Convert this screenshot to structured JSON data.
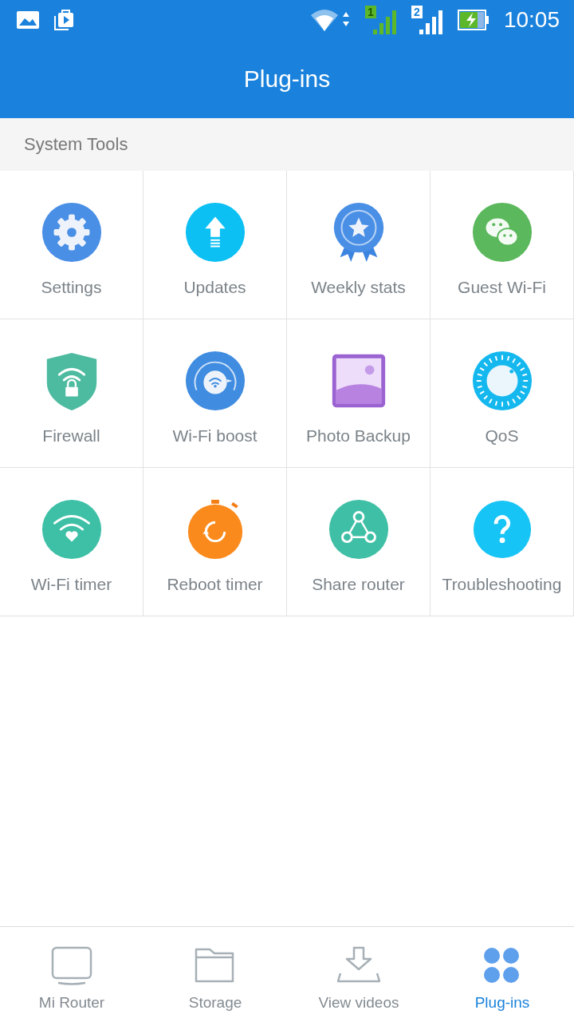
{
  "status_bar": {
    "sim_1": "1",
    "sim_2": "2",
    "time": "10:05"
  },
  "header": {
    "title": "Plug-ins"
  },
  "section": {
    "title": "System Tools"
  },
  "plugins": [
    {
      "kind": "settings",
      "label": "Settings"
    },
    {
      "kind": "updates",
      "label": "Updates"
    },
    {
      "kind": "stats",
      "label": "Weekly stats"
    },
    {
      "kind": "guest",
      "label": "Guest Wi-Fi"
    },
    {
      "kind": "firewall",
      "label": "Firewall"
    },
    {
      "kind": "boost",
      "label": "Wi-Fi boost"
    },
    {
      "kind": "photo",
      "label": "Photo Backup"
    },
    {
      "kind": "qos",
      "label": "QoS"
    },
    {
      "kind": "wifitimer",
      "label": "Wi-Fi timer"
    },
    {
      "kind": "reboot",
      "label": "Reboot timer"
    },
    {
      "kind": "share",
      "label": "Share router"
    },
    {
      "kind": "help",
      "label": "Troubleshooting"
    }
  ],
  "bottom_nav": [
    {
      "kind": "router",
      "label": "Mi Router",
      "selected": false
    },
    {
      "kind": "storage",
      "label": "Storage",
      "selected": false
    },
    {
      "kind": "videos",
      "label": "View videos",
      "selected": false
    },
    {
      "kind": "plugins",
      "label": "Plug-ins",
      "selected": true
    }
  ]
}
